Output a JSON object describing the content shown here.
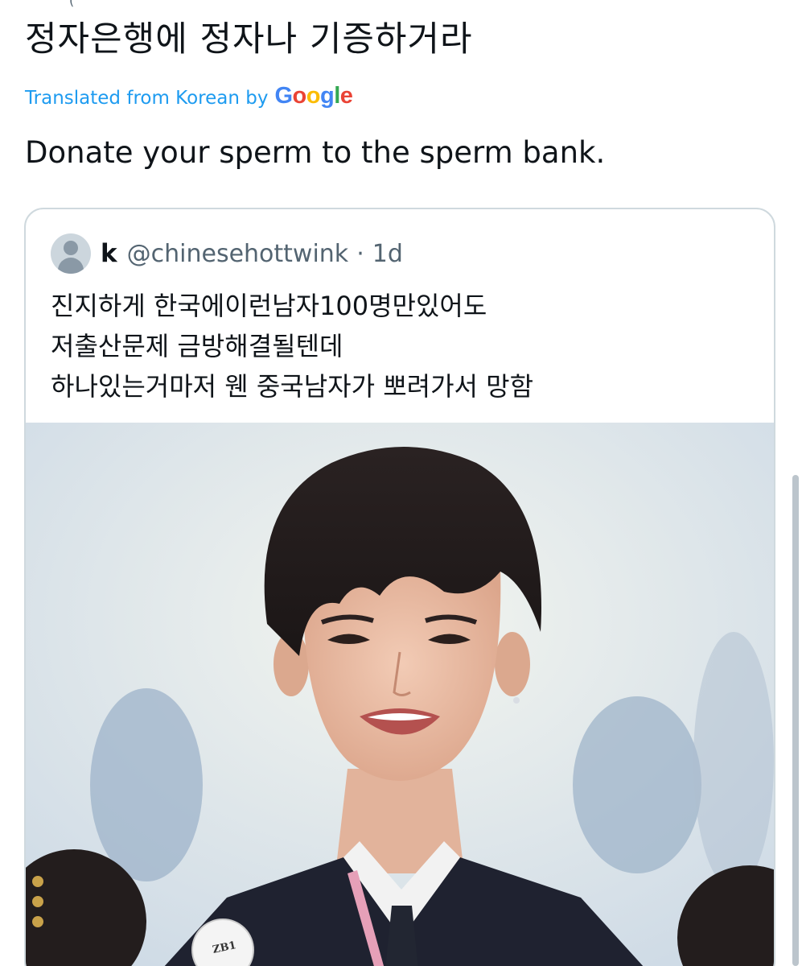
{
  "tweet": {
    "text": "정자은행에 정자나 기증하거라",
    "translated_label": "Translated from Korean by",
    "translator_brand": "Google",
    "translation": "Donate your sperm to the sperm bank."
  },
  "quote": {
    "display_name": "k",
    "handle": "@chinesehottwink",
    "separator": "·",
    "time": "1d",
    "lines": [
      "진지하게 한국에이런남자100명만있어도",
      "저출산문제 금방해결될텐데",
      "하나있는거마저 웬 중국남자가 뽀려가서 망함"
    ],
    "badge_text": "ZB1"
  },
  "colors": {
    "link_blue": "#1d9bf0",
    "text_dark": "#0f1419",
    "text_muted": "#536471",
    "border": "#cfd9de",
    "google_blue": "#4285f4",
    "google_red": "#ea4335",
    "google_yellow": "#fbbc05",
    "google_green": "#34a853"
  }
}
